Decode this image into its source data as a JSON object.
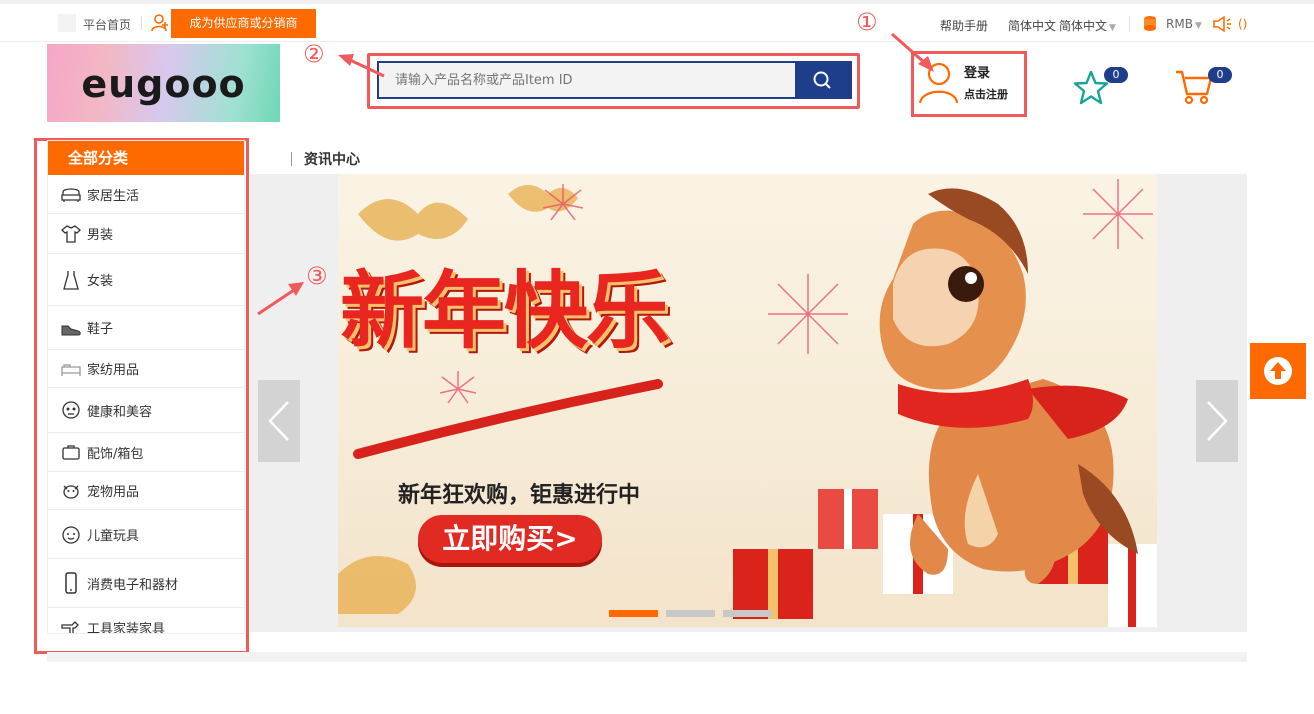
{
  "topbar": {
    "home_label": "平台首页",
    "supplier_button": "成为供应商或分销商",
    "help_label": "帮助手册",
    "language_label": "简体中文",
    "language_select": "简体中文",
    "currency_label": "RMB",
    "notice_count": "()"
  },
  "header": {
    "logo_text": "eugooo",
    "search_placeholder": "请输入产品名称或产品Item ID",
    "login_label": "登录",
    "register_label": "点击注册",
    "favorites_count": "0",
    "cart_count": "0"
  },
  "categories": {
    "title": "全部分类",
    "items": [
      {
        "label": "家居生活",
        "icon": "sofa-icon"
      },
      {
        "label": "男装",
        "icon": "shirt-icon"
      },
      {
        "label": "女装",
        "icon": "dress-icon"
      },
      {
        "label": "鞋子",
        "icon": "shoe-icon"
      },
      {
        "label": "家纺用品",
        "icon": "bedding-icon"
      },
      {
        "label": "健康和美容",
        "icon": "face-icon"
      },
      {
        "label": "配饰/箱包",
        "icon": "bag-icon"
      },
      {
        "label": "宠物用品",
        "icon": "pet-icon"
      },
      {
        "label": "儿童玩具",
        "icon": "baby-icon"
      },
      {
        "label": "消费电子和器材",
        "icon": "phone-icon"
      },
      {
        "label": "工具家装家具",
        "icon": "tool-icon"
      }
    ]
  },
  "main": {
    "news_label": "资讯中心"
  },
  "banner": {
    "title": "新年快乐",
    "subtitle": "新年狂欢购，钜惠进行中",
    "cta": "立即购买>"
  },
  "annotations": [
    "①",
    "②",
    "③"
  ],
  "colors": {
    "accent": "#ff6a00",
    "navy": "#1e3e8c",
    "annotation": "#f05a5a"
  }
}
